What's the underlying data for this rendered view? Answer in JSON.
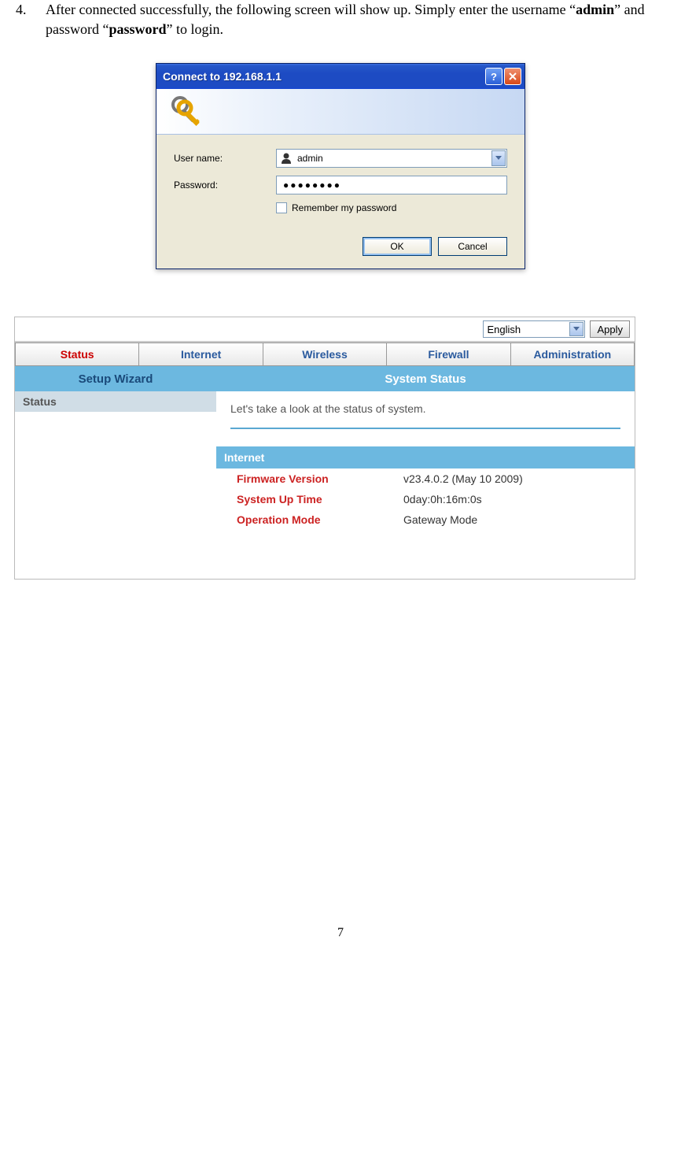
{
  "instruction": {
    "num": "4.",
    "text_pre": "After connected successfully, the following screen will show up. Simply enter the username “",
    "bold1": "admin",
    "text_mid": "” and password “",
    "bold2": "password",
    "text_post": "” to login."
  },
  "dialog": {
    "title": "Connect to 192.168.1.1",
    "username_label": "User name:",
    "password_label": "Password:",
    "username_value": "admin",
    "password_value": "●●●●●●●●",
    "remember_label": "Remember my password",
    "ok_label": "OK",
    "cancel_label": "Cancel"
  },
  "router": {
    "language": "English",
    "apply_label": "Apply",
    "tabs": [
      "Status",
      "Internet",
      "Wireless",
      "Firewall",
      "Administration"
    ],
    "sidebar": {
      "head": "Setup Wizard",
      "item0": "Status"
    },
    "content": {
      "head": "System Status",
      "intro": "Let's take a look at the status of system.",
      "section": "Internet",
      "rows": [
        {
          "k": "Firmware Version",
          "v": "v23.4.0.2 (May 10 2009)"
        },
        {
          "k": "System Up Time",
          "v": "0day:0h:16m:0s"
        },
        {
          "k": "Operation Mode",
          "v": "Gateway Mode"
        }
      ]
    }
  },
  "pagenum": "7"
}
